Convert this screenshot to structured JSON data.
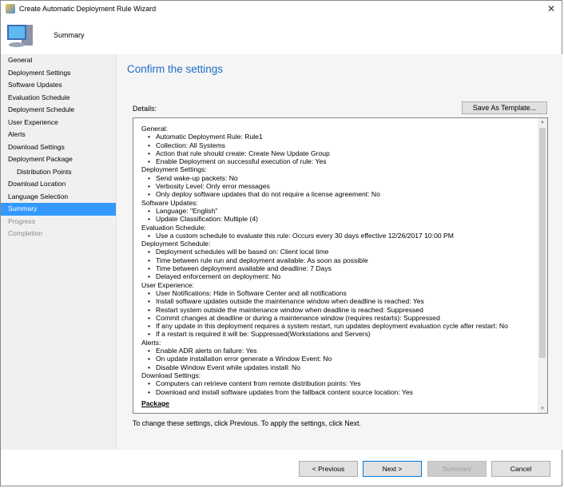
{
  "window": {
    "title": "Create Automatic Deployment Rule Wizard",
    "close": "✕"
  },
  "header": {
    "title": "Summary"
  },
  "sidebar": {
    "items": [
      {
        "label": "General",
        "state": "normal",
        "sub": false
      },
      {
        "label": "Deployment Settings",
        "state": "normal",
        "sub": false
      },
      {
        "label": "Software Updates",
        "state": "normal",
        "sub": false
      },
      {
        "label": "Evaluation Schedule",
        "state": "normal",
        "sub": false
      },
      {
        "label": "Deployment Schedule",
        "state": "normal",
        "sub": false
      },
      {
        "label": "User Experience",
        "state": "normal",
        "sub": false
      },
      {
        "label": "Alerts",
        "state": "normal",
        "sub": false
      },
      {
        "label": "Download Settings",
        "state": "normal",
        "sub": false
      },
      {
        "label": "Deployment Package",
        "state": "normal",
        "sub": false
      },
      {
        "label": "Distribution Points",
        "state": "normal",
        "sub": true
      },
      {
        "label": "Download Location",
        "state": "normal",
        "sub": false
      },
      {
        "label": "Language Selection",
        "state": "normal",
        "sub": false
      },
      {
        "label": "Summary",
        "state": "active",
        "sub": false
      },
      {
        "label": "Progress",
        "state": "disabled",
        "sub": false
      },
      {
        "label": "Completion",
        "state": "disabled",
        "sub": false
      }
    ]
  },
  "main": {
    "title": "Confirm the settings",
    "details_label": "Details:",
    "save_template": "Save As Template...",
    "sections": [
      {
        "heading": "General:",
        "items": [
          "Automatic Deployment Rule: Rule1",
          "Collection: All Systems",
          "Action that rule should create: Create New Update Group",
          "Enable Deployment on successful execution of rule: Yes"
        ]
      },
      {
        "heading": "Deployment Settings:",
        "items": [
          "Send wake-up packets: No",
          "Verbosity Level: Only error messages",
          "Only deploy software updates that do not require a license agreement: No"
        ]
      },
      {
        "heading": "Software Updates:",
        "items": [
          "Language: \"English\"",
          "Update Classification: Multiple (4)"
        ]
      },
      {
        "heading": "Evaluation Schedule:",
        "items": [
          "Use a custom schedule to evaluate this rule: Occurs every 30 days effective 12/26/2017 10:00 PM"
        ]
      },
      {
        "heading": "Deployment Schedule:",
        "items": [
          "Deployment schedules will be based on: Client local time",
          "Time between rule run and deployment available: As soon as possible",
          "Time between deployment available and deadline: 7 Days",
          "Delayed enforcement on deployment: No"
        ]
      },
      {
        "heading": "User Experience:",
        "items": [
          "User Notifications: Hide in Software Center and all notifications",
          "Install software updates outside the maintenance window when deadline is reached: Yes",
          "Restart system outside the maintenance window when deadline is reached: Suppressed",
          "Commit changes at deadline or during a maintenance window (requires restarts): Suppressed",
          "If any update in this deployment requires a system restart, run updates deployment evaluation cycle after restart: No",
          "If a restart is required it will be: Suppressed(Workstations and Servers)"
        ]
      },
      {
        "heading": "Alerts:",
        "items": [
          "Enable ADR alerts on failure: Yes",
          "On update installation error generate a Window Event: No",
          "Disable Window Event while updates install: No"
        ]
      },
      {
        "heading": "Download Settings:",
        "items": [
          "Computers can retrieve content from remote distribution points: Yes",
          "Download and install software updates from the fallback content source location: Yes"
        ]
      }
    ],
    "package_heading": "Package",
    "footer_text": "To change these settings, click Previous. To apply the settings, click Next."
  },
  "buttons": {
    "previous": "< Previous",
    "next": "Next >",
    "summary": "Summary",
    "cancel": "Cancel"
  }
}
